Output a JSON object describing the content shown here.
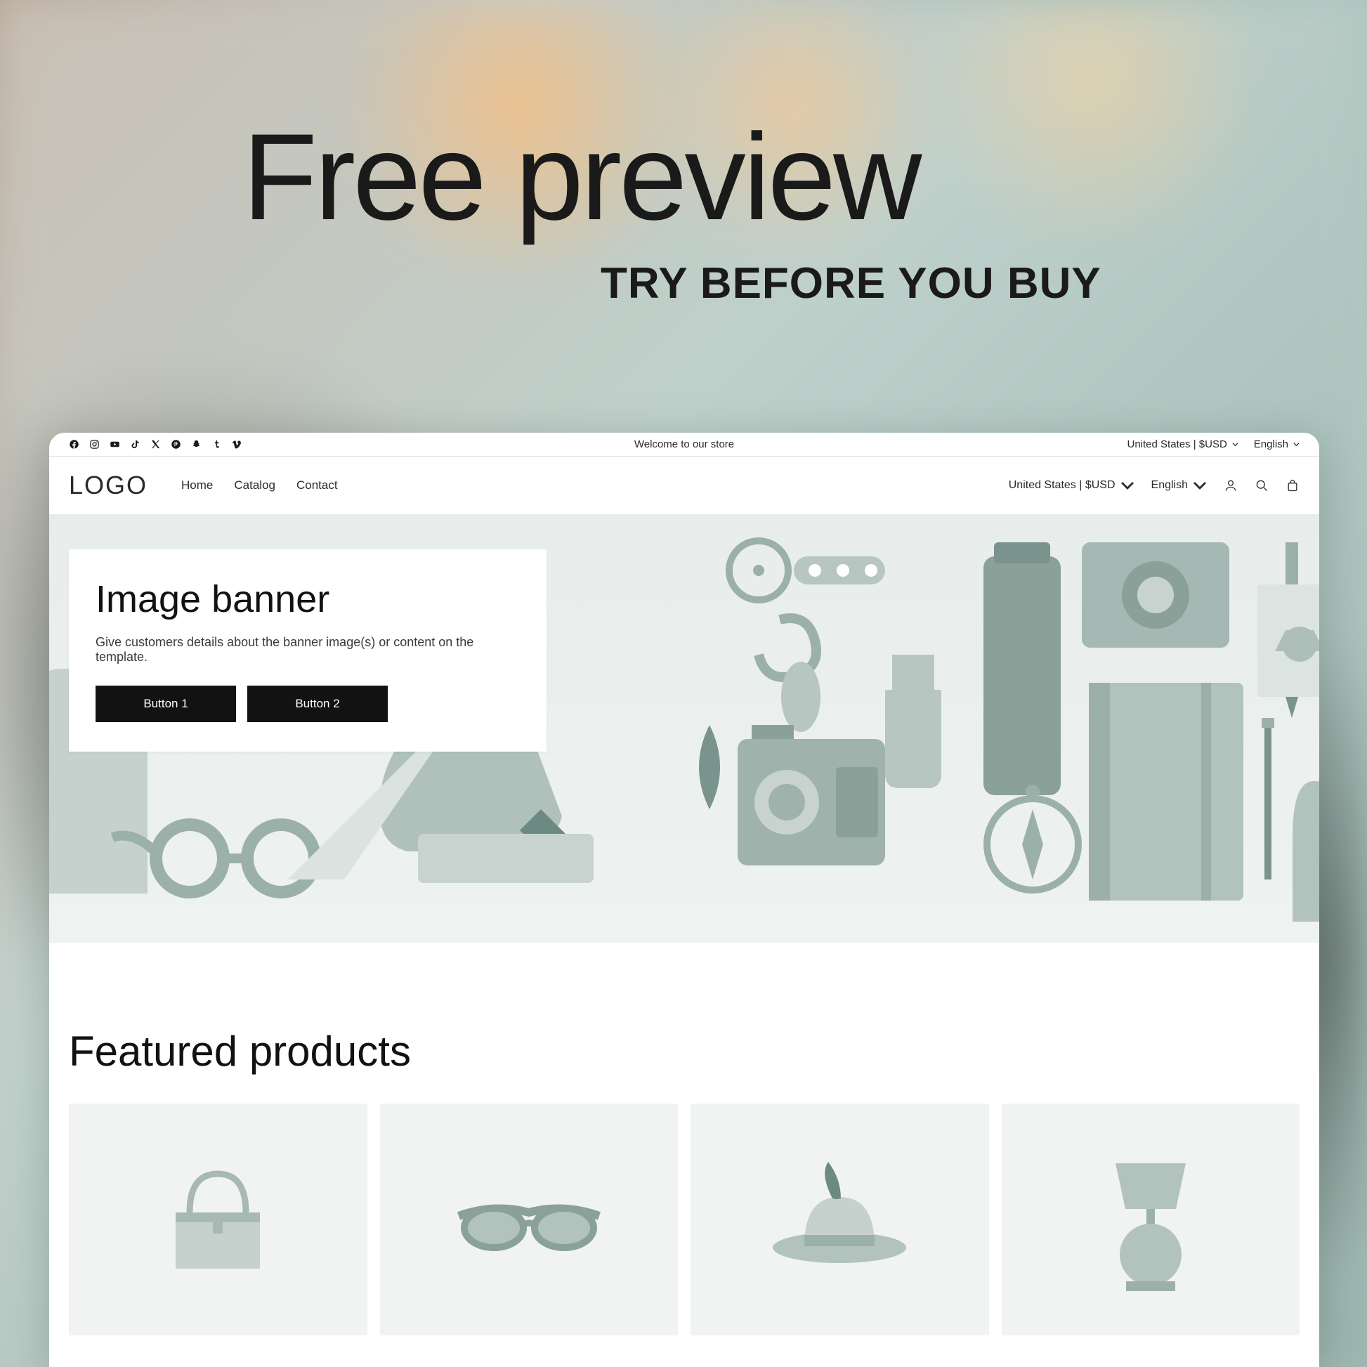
{
  "promo": {
    "title": "Free preview",
    "subtitle": "TRY BEFORE YOU BUY"
  },
  "announcement": {
    "welcome": "Welcome to our store",
    "region": "United States | $USD",
    "language": "English"
  },
  "header": {
    "logo": "LOGO",
    "nav": [
      "Home",
      "Catalog",
      "Contact"
    ],
    "region": "United States | $USD",
    "language": "English"
  },
  "hero": {
    "title": "Image banner",
    "description": "Give customers details about the banner image(s) or content on the template.",
    "button1": "Button 1",
    "button2": "Button 2"
  },
  "featured": {
    "title": "Featured products"
  }
}
